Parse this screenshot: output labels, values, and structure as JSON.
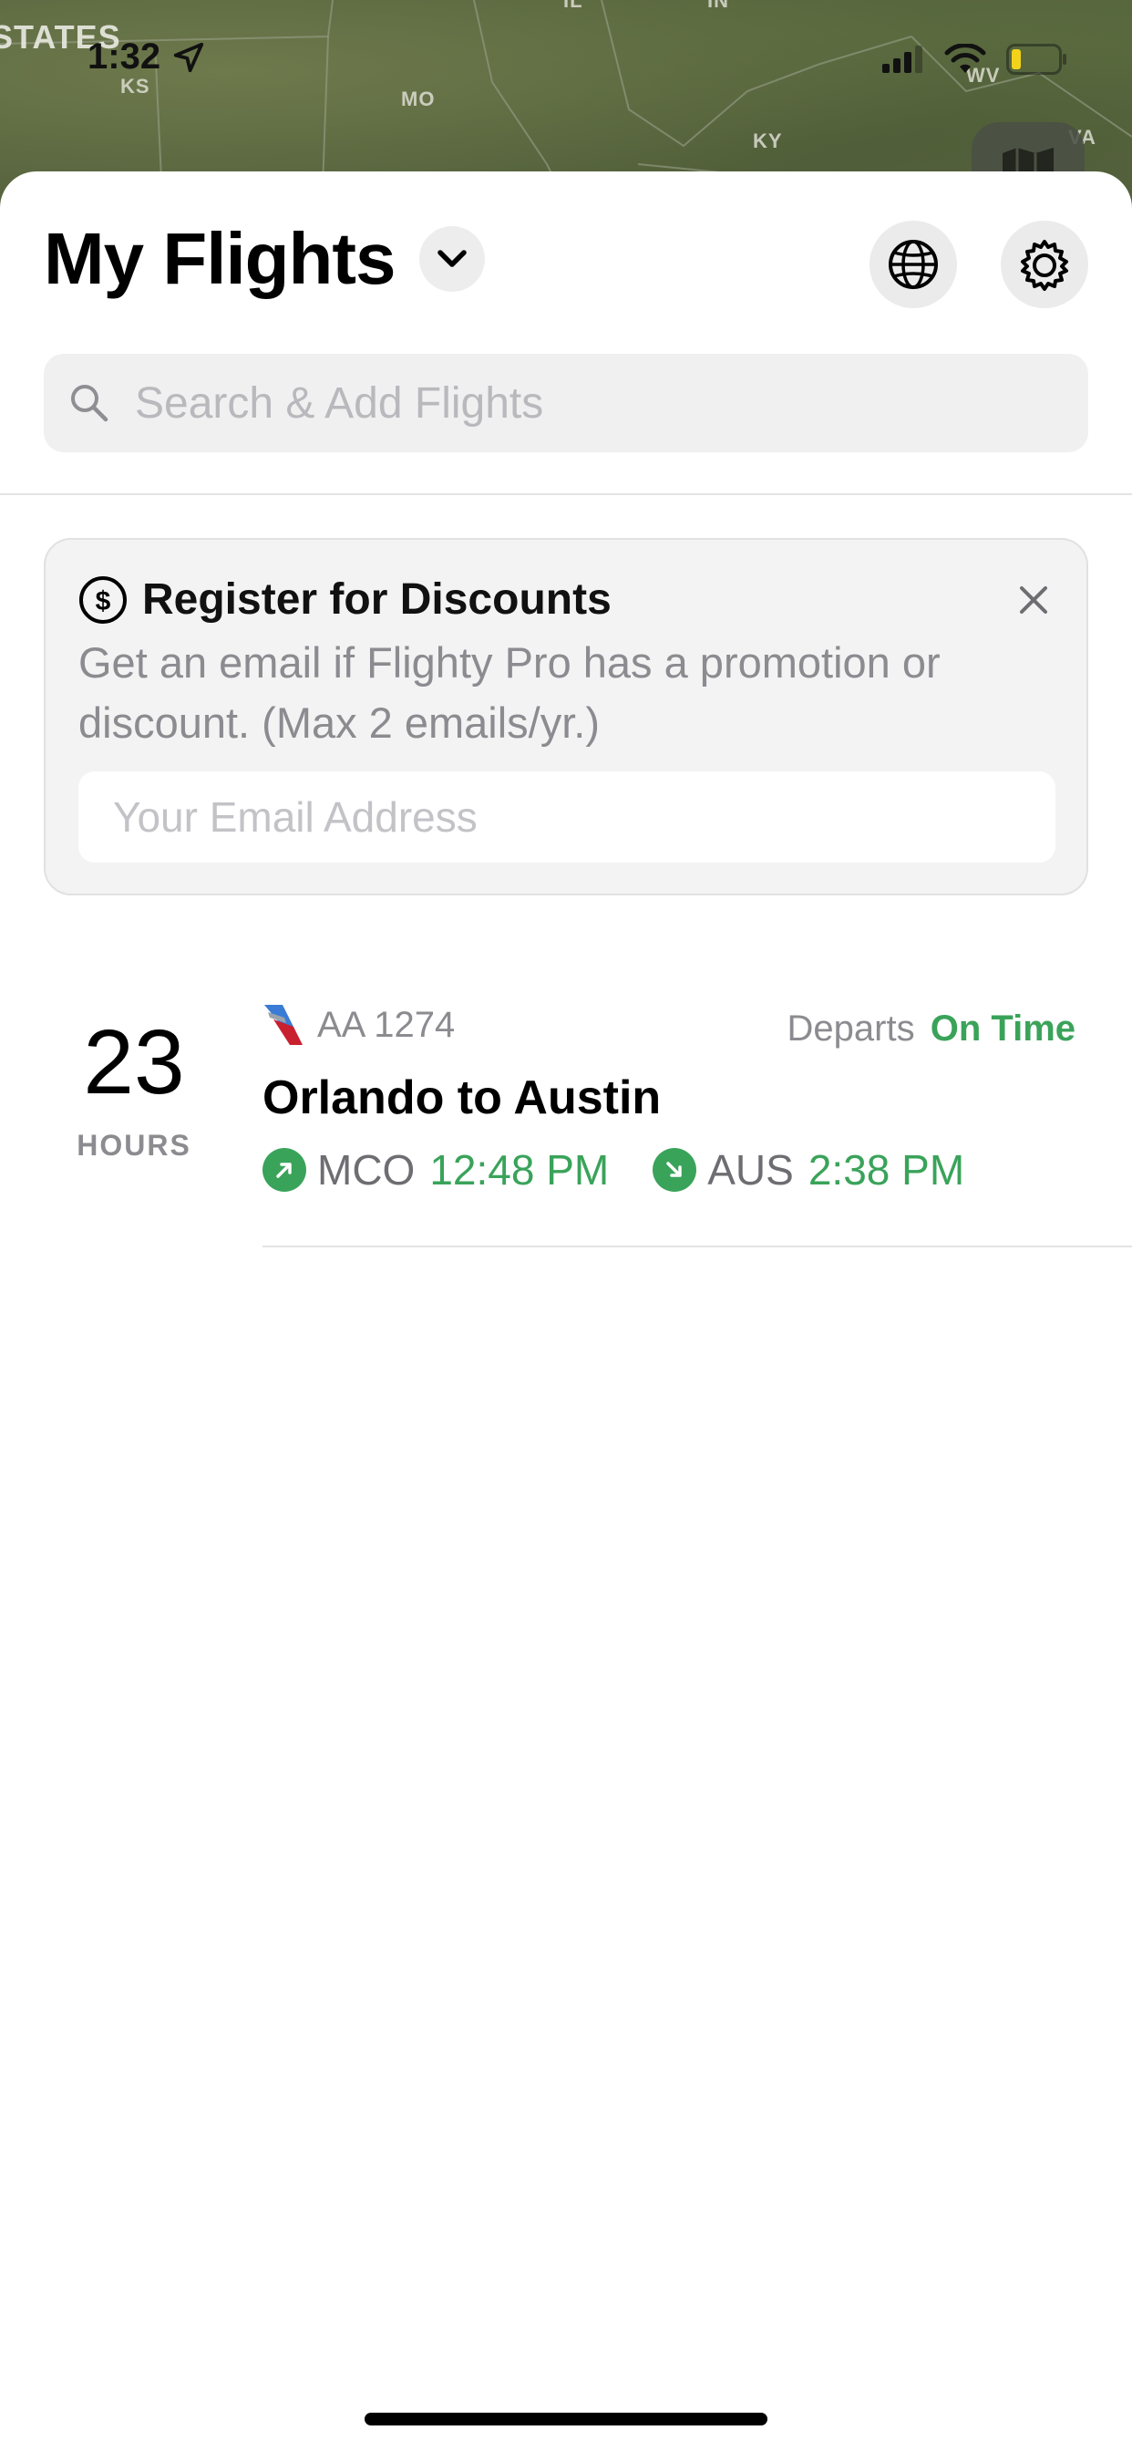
{
  "status_bar": {
    "time": "1:32"
  },
  "map": {
    "labels": {
      "states": "STATES",
      "ks": "KS",
      "mo": "MO",
      "ky": "KY",
      "wv": "WV",
      "va": "VA",
      "il": "IL",
      "in": "IN"
    }
  },
  "header": {
    "title": "My Flights"
  },
  "search": {
    "placeholder": "Search & Add Flights"
  },
  "promo": {
    "title": "Register for Discounts",
    "body": "Get an email if Flighty Pro has a promotion or discount. (Max 2 emails/yr.)",
    "email_placeholder": "Your Email Address"
  },
  "flights": [
    {
      "countdown_value": "23",
      "countdown_unit": "HOURS",
      "flight_number": "AA 1274",
      "status_prefix": "Departs",
      "status": "On Time",
      "route": "Orlando to Austin",
      "departure": {
        "code": "MCO",
        "time": "12:48 PM"
      },
      "arrival": {
        "code": "AUS",
        "time": "2:38 PM"
      }
    }
  ],
  "colors": {
    "accent_green": "#3aa35a",
    "secondary_text": "#8b8b90",
    "airline_red": "#c8202f",
    "airline_blue": "#3a7bd5"
  },
  "icons": {
    "search": "search-icon",
    "chevron": "chevron-down-icon",
    "globe": "globe-icon",
    "settings": "gear-icon",
    "dollar": "dollar-circle-icon",
    "close": "close-icon",
    "map": "map-icon",
    "takeoff": "arrow-up-right-icon",
    "landing": "arrow-down-right-icon"
  }
}
